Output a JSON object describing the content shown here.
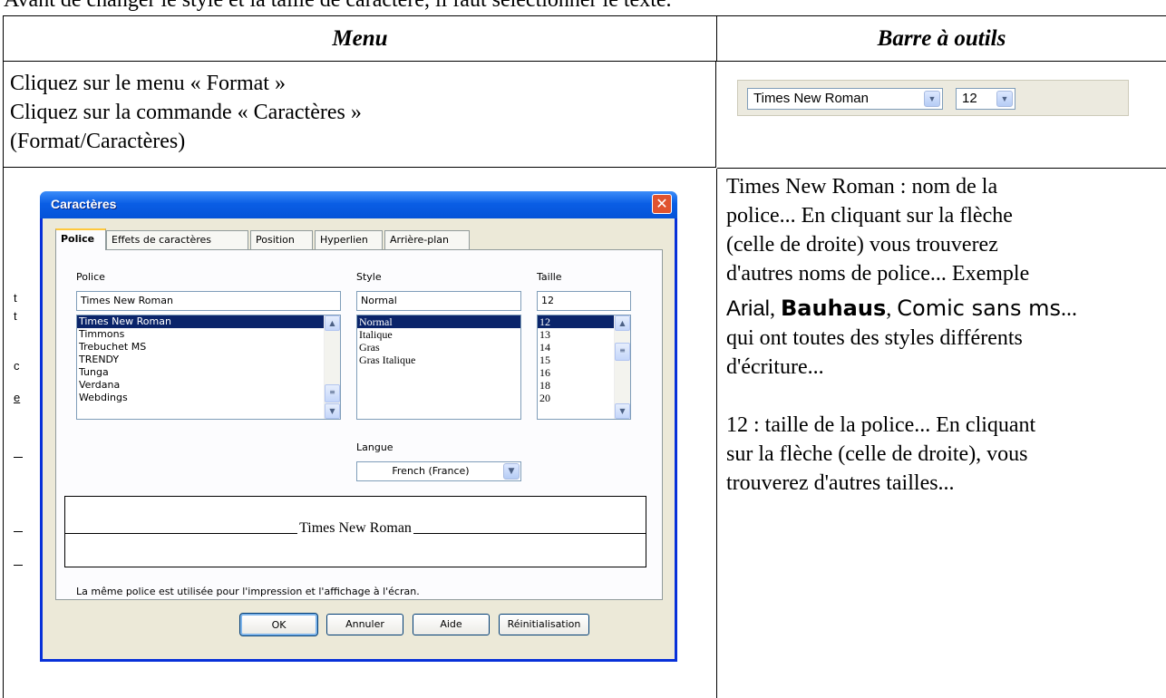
{
  "intro_text": "Avant de changer le style et la taille de caractère, il faut sélectionner le texte.",
  "table": {
    "header_menu": "Menu",
    "header_toolbar": "Barre à outils",
    "menu_steps": [
      "Cliquez sur le menu « Format »",
      "Cliquez sur la commande « Caractères »",
      "(Format/Caractères)"
    ],
    "toolbar": {
      "font_value": "Times New Roman",
      "size_value": "12"
    },
    "explanation": {
      "p1_lines": [
        "Times New Roman : nom de la",
        "police... En cliquant sur la flèche",
        "(celle de droite) vous trouverez",
        "d'autres noms de police... Exemple"
      ],
      "font_arial": "Arial",
      "font_bauhaus": "Bauhaus",
      "font_comic": "Comic sans ms",
      "sep": ", ",
      "ellipsis": "...",
      "p1_tail_lines": [
        "qui ont toutes des styles différents",
        "d'écriture..."
      ],
      "p2_lines": [
        "12 : taille de la police... En cliquant",
        "sur la flèche (celle de droite), vous",
        "trouverez d'autres tailles..."
      ]
    }
  },
  "dialog": {
    "title": "Caractères",
    "close_glyph": "✕",
    "tabs": [
      "Police",
      "Effets de caractères",
      "Position",
      "Hyperlien",
      "Arrière-plan"
    ],
    "font_label": "Police",
    "font_input": "Times New Roman",
    "font_list": [
      "Times New Roman",
      "Timmons",
      "Trebuchet MS",
      "TRENDY",
      "Tunga",
      "Verdana",
      "Webdings"
    ],
    "style_label": "Style",
    "style_input": "Normal",
    "style_list": [
      "Normal",
      "Italique",
      "Gras",
      "Gras Italique"
    ],
    "size_label": "Taille",
    "size_input": "12",
    "size_list": [
      "12",
      "13",
      "14",
      "15",
      "16",
      "18",
      "20"
    ],
    "language_label": "Langue",
    "language_value": "French (France)",
    "preview_text": "Times New Roman",
    "note": "La même police est utilisée pour l'impression et l'affichage à l'écran.",
    "buttons": {
      "ok": "OK",
      "cancel": "Annuler",
      "help": "Aide",
      "reset": "Réinitialisation"
    }
  },
  "background_fragments": [
    "t",
    "t",
    "c",
    "e"
  ],
  "colors": {
    "titlebar": "#0a5ee5",
    "selection": "#0a246a",
    "close": "#e0532f"
  }
}
